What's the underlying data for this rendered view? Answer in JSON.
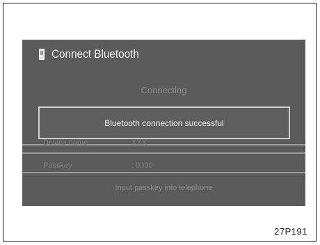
{
  "screen": {
    "title": "Connect Bluetooth",
    "status": "Connecting",
    "rows": [
      {
        "label": "Device name",
        "value": "XXX"
      },
      {
        "label": "Passkey",
        "value": ": 0000"
      }
    ],
    "hint": "Input passkey into telephone",
    "dialog_message": "Bluetooth connection successful",
    "colors": {
      "screen_bg": "#5b5b5b",
      "text": "#eaeaea",
      "dialog_border": "#cfcfcf"
    }
  },
  "figure_code": "27P191"
}
